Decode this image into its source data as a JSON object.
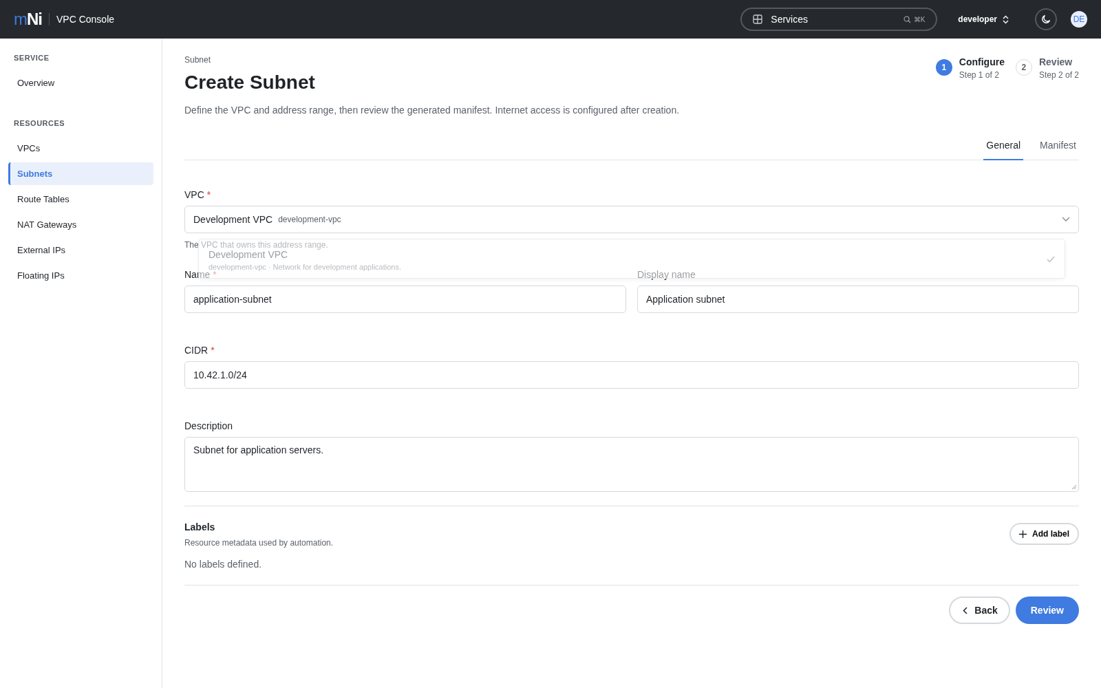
{
  "header": {
    "logo_prefix": "m",
    "logo_suffix": "Ni",
    "app_name": "VPC Console",
    "search": {
      "label": "Services",
      "shortcut": "⌘K"
    },
    "account": "developer",
    "avatar": "DE"
  },
  "sidebar": {
    "sections": [
      {
        "title": "SERVICE",
        "items": [
          {
            "label": "Overview",
            "selected": false
          }
        ]
      },
      {
        "title": "RESOURCES",
        "items": [
          {
            "label": "VPCs",
            "selected": false
          },
          {
            "label": "Subnets",
            "selected": true
          },
          {
            "label": "Route Tables",
            "selected": false
          },
          {
            "label": "NAT Gateways",
            "selected": false
          },
          {
            "label": "External IPs",
            "selected": false
          },
          {
            "label": "Floating IPs",
            "selected": false
          }
        ]
      }
    ]
  },
  "page": {
    "breadcrumb": "Subnet",
    "title": "Create Subnet",
    "description": "Define the VPC and address range, then review the generated manifest. Internet access is configured after creation."
  },
  "steps": [
    {
      "number": "1",
      "title": "Configure",
      "subtitle": "Step 1 of 2",
      "selected": true
    },
    {
      "number": "2",
      "title": "Review",
      "subtitle": "Step 2 of 2",
      "selected": false
    }
  ],
  "tabs": [
    {
      "label": "General",
      "selected": true
    },
    {
      "label": "Manifest",
      "selected": false
    }
  ],
  "form": {
    "required_mark": "*",
    "rows": [
      {
        "fields": [
          {
            "kind": "select",
            "label": "VPC",
            "required": true,
            "value": "Development VPC",
            "value_id": "development-vpc",
            "help": "The VPC that owns this address range.",
            "menu": {
              "open": true,
              "options": [
                {
                  "name": "Development VPC",
                  "detail": "development-vpc · Network for development applications.",
                  "selected": true
                }
              ]
            }
          }
        ]
      },
      {
        "fields": [
          {
            "kind": "text",
            "label": "Name",
            "required": true,
            "value": "application-subnet"
          },
          {
            "kind": "text",
            "label": "Display name",
            "required": false,
            "value": "Application subnet"
          }
        ]
      },
      {
        "fields": [
          {
            "kind": "text",
            "label": "CIDR",
            "required": true,
            "value": "10.42.1.0/24"
          }
        ]
      },
      {
        "fields": [
          {
            "kind": "textarea",
            "label": "Description",
            "required": false,
            "value": "Subnet for application servers."
          }
        ]
      }
    ]
  },
  "labels": {
    "title": "Labels",
    "subtitle": "Resource metadata used by automation.",
    "empty": "No labels defined.",
    "add_button": "Add label"
  },
  "actions": {
    "back": "Back",
    "next": "Review"
  }
}
